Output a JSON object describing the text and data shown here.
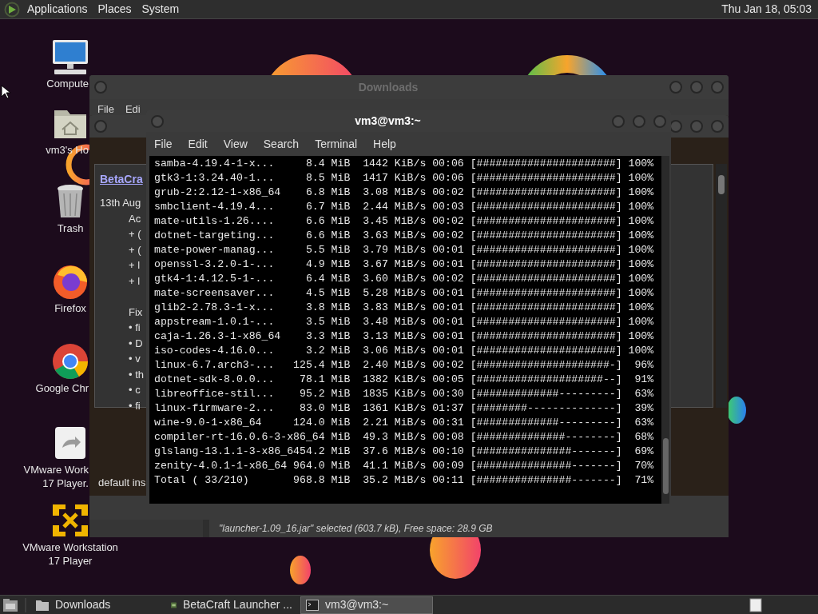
{
  "top_panel": {
    "menus": [
      "Applications",
      "Places",
      "System"
    ],
    "clock": "Thu Jan 18, 05:03"
  },
  "desktop_icons": [
    {
      "kind": "computer",
      "lines": [
        "Compute"
      ],
      "partly_hidden": true
    },
    {
      "kind": "home",
      "lines": [
        "vm3's Ho"
      ],
      "partly_hidden": true
    },
    {
      "kind": "trash",
      "lines": [
        "Trash"
      ],
      "partly_hidden": false
    },
    {
      "kind": "firefox",
      "lines": [
        "Firefox"
      ],
      "partly_hidden": false
    },
    {
      "kind": "chrome",
      "lines": [
        "Google Chr"
      ],
      "partly_hidden": true
    },
    {
      "kind": "file",
      "lines": [
        "VMware Work",
        "17 Player."
      ],
      "partly_hidden": true
    },
    {
      "kind": "vmware",
      "lines": [
        "VMware Workstation",
        "17 Player"
      ],
      "partly_hidden": false
    }
  ],
  "downloads_window": {
    "title": "Downloads",
    "active": false,
    "menus": [
      "File",
      "Edi"
    ],
    "status": "\"launcher-1.09_16.jar\" selected (603.7 kB), Free space: 28.9 GB"
  },
  "launcher_window": {
    "link": "BetaCra",
    "date": "13th Aug",
    "heading": "Ac",
    "added": [
      "+ (",
      "+ (",
      "+ l",
      "+ l"
    ],
    "fixes_heading": "Fix",
    "fixes": [
      "• fi",
      "• D",
      "• v",
      "• th",
      "• c",
      "• fi"
    ],
    "footer": "default ins"
  },
  "terminal_window": {
    "title": "vm3@vm3:~",
    "active": true,
    "menus": [
      "File",
      "Edit",
      "View",
      "Search",
      "Terminal",
      "Help"
    ],
    "lines": [
      "samba-4.19.4-1-x...     8.4 MiB  1442 KiB/s 00:06 [######################] 100%",
      "gtk3-1:3.24.40-1...     8.5 MiB  1417 KiB/s 00:06 [######################] 100%",
      "grub-2:2.12-1-x86_64    6.8 MiB  3.08 MiB/s 00:02 [######################] 100%",
      "smbclient-4.19.4...     6.7 MiB  2.44 MiB/s 00:03 [######################] 100%",
      "mate-utils-1.26....     6.6 MiB  3.45 MiB/s 00:02 [######################] 100%",
      "dotnet-targeting...     6.6 MiB  3.63 MiB/s 00:02 [######################] 100%",
      "mate-power-manag...     5.5 MiB  3.79 MiB/s 00:01 [######################] 100%",
      "openssl-3.2.0-1-...     4.9 MiB  3.67 MiB/s 00:01 [######################] 100%",
      "gtk4-1:4.12.5-1-...     6.4 MiB  3.60 MiB/s 00:02 [######################] 100%",
      "mate-screensaver...     4.5 MiB  5.28 MiB/s 00:01 [######################] 100%",
      "glib2-2.78.3-1-x...     3.8 MiB  3.83 MiB/s 00:01 [######################] 100%",
      "appstream-1.0.1-...     3.5 MiB  3.48 MiB/s 00:01 [######################] 100%",
      "caja-1.26.3-1-x86_64    3.3 MiB  3.13 MiB/s 00:01 [######################] 100%",
      "iso-codes-4.16.0...     3.2 MiB  3.06 MiB/s 00:01 [######################] 100%",
      "linux-6.7.arch3-...   125.4 MiB  2.40 MiB/s 00:02 [#####################-]  96%",
      "dotnet-sdk-8.0.0...    78.1 MiB  1382 KiB/s 00:05 [####################--]  91%",
      "libreoffice-stil...    95.2 MiB  1835 KiB/s 00:30 [#############---------]  63%",
      "linux-firmware-2...    83.0 MiB  1361 KiB/s 01:37 [########--------------]  39%",
      "wine-9.0-1-x86_64     124.0 MiB  2.21 MiB/s 00:31 [#############---------]  63%",
      "compiler-rt-16.0.6-3-x86_64 MiB  49.3 MiB/s 00:08 [##############--------]  68%",
      "glslang-13.1.1-3-x86_6454.2 MiB  37.6 MiB/s 00:10 [###############-------]  69%",
      "zenity-4.0.1-1-x86_64 964.0 MiB  41.1 MiB/s 00:09 [###############-------]  70%",
      "Total ( 33/210)       968.8 MiB  35.2 MiB/s 00:11 [###############-------]  71%"
    ]
  },
  "taskbar": {
    "items": [
      {
        "kind": "folder",
        "label": "Downloads",
        "selected": false
      },
      {
        "kind": "app",
        "label": "BetaCraft Launcher ...",
        "selected": false
      },
      {
        "kind": "terminal",
        "label": "vm3@vm3:~",
        "selected": true
      }
    ]
  }
}
